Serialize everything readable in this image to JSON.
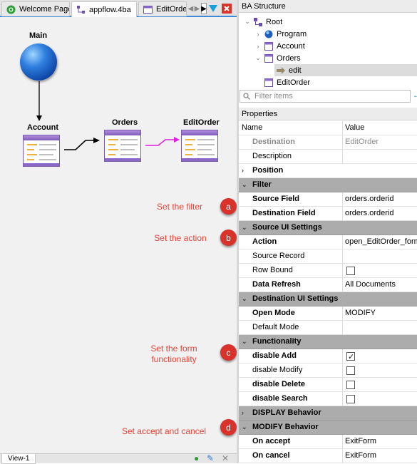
{
  "tabs": [
    {
      "label": "Welcome Page"
    },
    {
      "label": "appflow.4ba"
    },
    {
      "label": "EditOrder."
    }
  ],
  "view_tab": "View-1",
  "diagram": {
    "main": "Main",
    "account": "Account",
    "orders": "Orders",
    "editorder": "EditOrder"
  },
  "callouts": [
    {
      "letter": "a",
      "text": "Set the filter"
    },
    {
      "letter": "b",
      "text": "Set the action"
    },
    {
      "letter": "c",
      "text": "Set the form functionality"
    },
    {
      "letter": "d",
      "text": "Set  accept and cancel"
    }
  ],
  "structure": {
    "title": "BA Structure",
    "items": [
      {
        "label": "Root"
      },
      {
        "label": "Program"
      },
      {
        "label": "Account"
      },
      {
        "label": "Orders"
      },
      {
        "label": "edit"
      },
      {
        "label": "EditOrder"
      }
    ],
    "filter_placeholder": "Filter items"
  },
  "properties": {
    "title": "Properties",
    "col_name": "Name",
    "col_value": "Value",
    "rows": [
      {
        "name": "Destination",
        "value": "EditOrder"
      },
      {
        "name": "Description",
        "value": ""
      },
      {
        "name": "Position",
        "value": ""
      },
      {
        "name": "Filter",
        "value": ""
      },
      {
        "name": "Source Field",
        "value": "orders.orderid"
      },
      {
        "name": "Destination Field",
        "value": "orders.orderid"
      },
      {
        "name": "Source UI Settings",
        "value": ""
      },
      {
        "name": "Action",
        "value": "open_EditOrder_form"
      },
      {
        "name": "Source Record",
        "value": ""
      },
      {
        "name": "Row Bound",
        "value": "",
        "checked": false
      },
      {
        "name": "Data Refresh",
        "value": "All Documents"
      },
      {
        "name": "Destination UI Settings",
        "value": ""
      },
      {
        "name": "Open Mode",
        "value": "MODIFY"
      },
      {
        "name": "Default Mode",
        "value": ""
      },
      {
        "name": "Functionality",
        "value": ""
      },
      {
        "name": "disable Add",
        "value": "",
        "checked": true
      },
      {
        "name": "disable Modify",
        "value": "",
        "checked": false
      },
      {
        "name": "disable Delete",
        "value": "",
        "checked": false
      },
      {
        "name": "disable Search",
        "value": "",
        "checked": false
      },
      {
        "name": "DISPLAY Behavior",
        "value": ""
      },
      {
        "name": "MODIFY Behavior",
        "value": ""
      },
      {
        "name": "On accept",
        "value": "ExitForm"
      },
      {
        "name": "On cancel",
        "value": "ExitForm"
      }
    ]
  },
  "colors": {
    "accent": "#3c8ad8",
    "callout": "#d8322b",
    "category": "#acacac"
  }
}
